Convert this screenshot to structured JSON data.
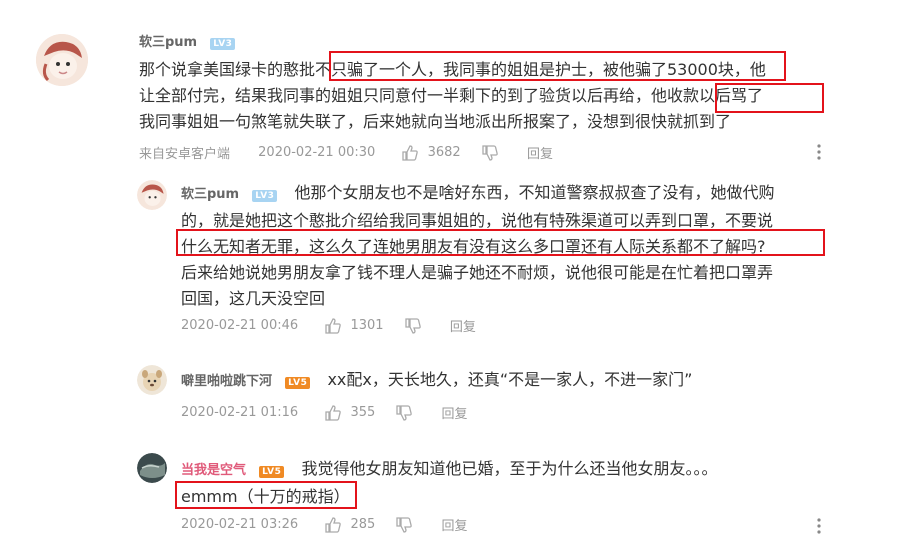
{
  "comments": [
    {
      "username": "软三pum",
      "level": "LV3",
      "line1": "那个说拿美国绿卡的憨批不只骗了一个人，我同事的姐姐是护士，被他骗了53000块，他",
      "line2": "让全部付完，结果我同事的姐姐只同意付一半剩下的到了验货以后再给，他收款以后骂了",
      "line3": "我同事姐姐一句煞笔就失联了，后来她就向当地派出所报案了，没想到很快就抓到了",
      "source": "来自安卓客户端",
      "time": "2020-02-21 00:30",
      "likes": "3682",
      "reply": "回复"
    },
    {
      "username": "软三pum",
      "level": "LV3",
      "line1": "他那个女朋友也不是啥好东西，不知道警察叔叔查了没有，她做代购",
      "line2": "的，就是她把这个憨批介绍给我同事姐姐的，说他有特殊渠道可以弄到口罩，不要说",
      "line3": "什么无知者无罪，这么久了连她男朋友有没有这么多口罩还有人际关系都不了解吗?",
      "line4": "后来给她说她男朋友拿了钱不理人是骗子她还不耐烦，说他很可能是在忙着把口罩弄",
      "line5": "回国，这几天没空回",
      "time": "2020-02-21 00:46",
      "likes": "1301",
      "reply": "回复"
    },
    {
      "username": "噼里啪啦跳下河",
      "level": "LV5",
      "line1": "xx配x，天长地久，还真“不是一家人，不进一家门”",
      "time": "2020-02-21 01:16",
      "likes": "355",
      "reply": "回复"
    },
    {
      "username": "当我是空气",
      "level": "LV5",
      "line1": "我觉得他女朋友知道他已婚，至于为什么还当他女朋友。。。",
      "line2": "emmm（十万的戒指）",
      "time": "2020-02-21 03:26",
      "likes": "285",
      "reply": "回复"
    }
  ],
  "colors": {
    "highlight_box": "#e3131b",
    "level_blue": "#a8d4f2",
    "level_orange": "#f08a24",
    "username_pink": "#e05a7a"
  }
}
